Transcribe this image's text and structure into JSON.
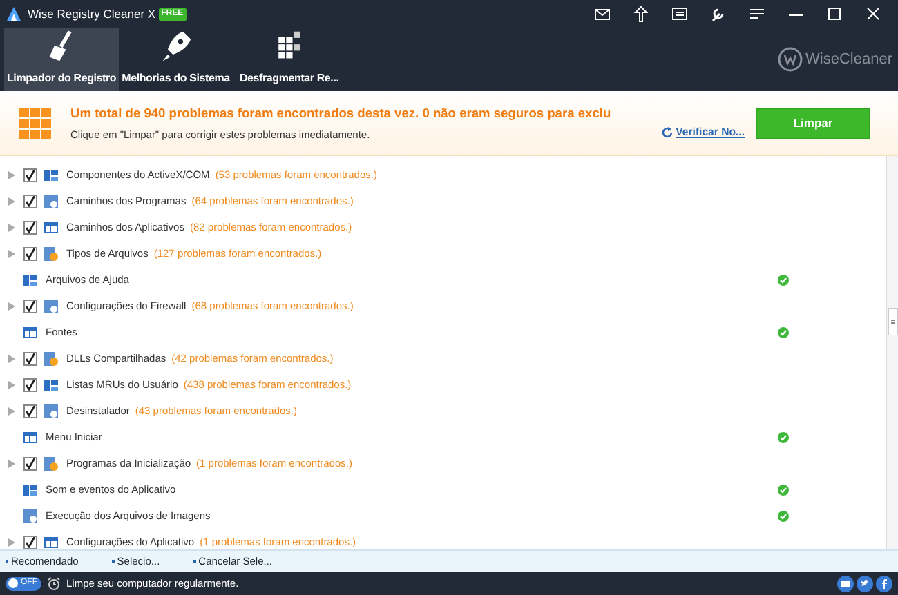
{
  "window": {
    "title": "Wise Registry Cleaner X",
    "badge": "FREE"
  },
  "tabs": [
    {
      "label": "Limpador do Registro",
      "selected": true,
      "kind": "broom"
    },
    {
      "label": "Melhorias do Sistema",
      "selected": false,
      "kind": "rocket"
    },
    {
      "label": "Desfragmentar Re...",
      "selected": false,
      "kind": "blocks"
    }
  ],
  "brand": "WiseCleaner",
  "summary": {
    "headline": "Um total de 940 problemas foram encontrados desta vez. 0 não eram seguros para exclu",
    "hint": "Clique em \"Limpar\" para corrigir estes problemas imediatamente.",
    "recheck_link": "Verificar No...",
    "clean_button": "Limpar"
  },
  "items": [
    {
      "kind": "problem",
      "name": "Componentes do ActiveX/COM",
      "count": "(53 problemas foram encontrados.)",
      "checked": true
    },
    {
      "kind": "problem",
      "name": "Caminhos dos Programas",
      "count": "(64 problemas foram encontrados.)",
      "checked": true
    },
    {
      "kind": "problem",
      "name": "Caminhos dos Aplicativos",
      "count": "(82 problemas foram encontrados.)",
      "checked": true
    },
    {
      "kind": "problem",
      "name": "Tipos de Arquivos",
      "count": "(127 problemas foram encontrados.)",
      "checked": true
    },
    {
      "kind": "clean",
      "name": "Arquivos de Ajuda"
    },
    {
      "kind": "problem",
      "name": "Configurações do Firewall",
      "count": "(68 problemas foram encontrados.)",
      "checked": true
    },
    {
      "kind": "clean",
      "name": "Fontes"
    },
    {
      "kind": "problem",
      "name": "DLLs Compartilhadas",
      "count": "(42 problemas foram encontrados.)",
      "checked": true
    },
    {
      "kind": "problem",
      "name": "Listas MRUs do Usuário",
      "count": "(438 problemas foram encontrados.)",
      "checked": true
    },
    {
      "kind": "problem",
      "name": "Desinstalador",
      "count": "(43 problemas foram encontrados.)",
      "checked": true
    },
    {
      "kind": "clean",
      "name": "Menu Iniciar"
    },
    {
      "kind": "problem",
      "name": "Programas da Inicialização",
      "count": "(1 problemas foram encontrados.)",
      "checked": true
    },
    {
      "kind": "clean",
      "name": "Som e eventos do Aplicativo"
    },
    {
      "kind": "clean",
      "name": "Execução dos Arquivos de Imagens"
    },
    {
      "kind": "problem",
      "name": "Configurações do Aplicativo",
      "count": "(1 problemas foram encontrados.)",
      "checked": true
    }
  ],
  "selection_links": [
    "Recomendado",
    "Selecio...",
    "Cancelar Sele..."
  ],
  "status_bar": {
    "toggle": {
      "label": "OFF",
      "on": false
    },
    "message": "Limpe seu computador regularmente."
  }
}
